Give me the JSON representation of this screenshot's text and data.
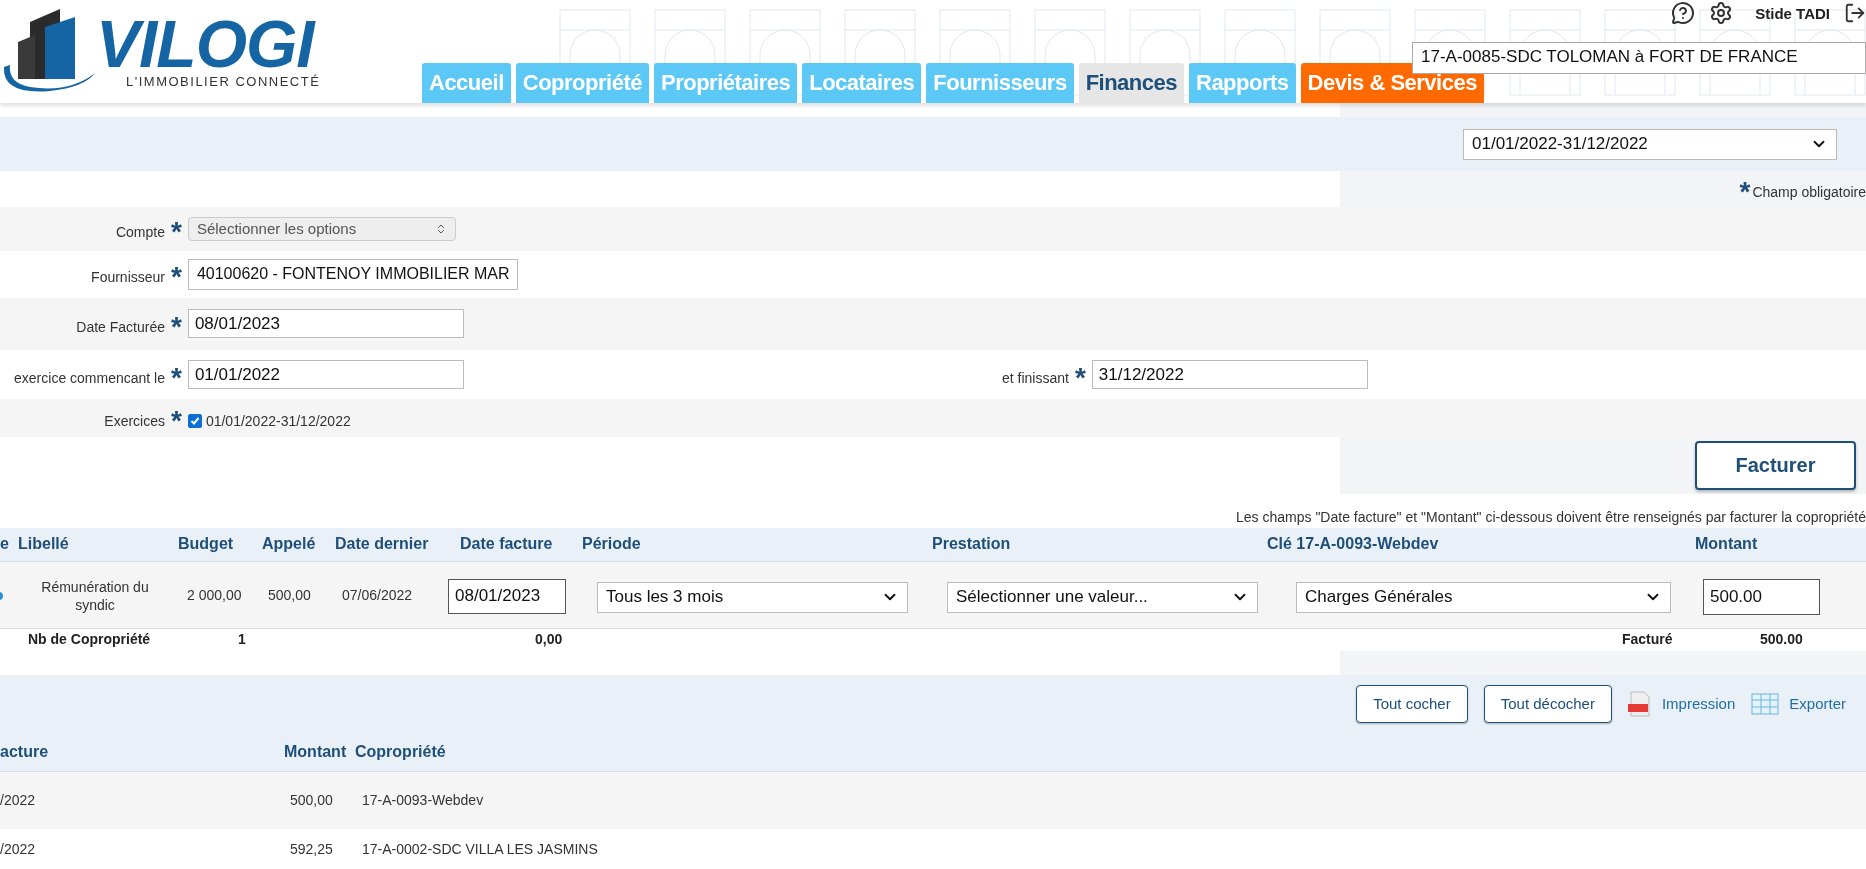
{
  "header": {
    "logo": {
      "name": "VILOGI",
      "tagline": "L'IMMOBILIER CONNECTÉ"
    },
    "tabs": [
      {
        "label": "Accueil",
        "selected": false,
        "kind": "normal"
      },
      {
        "label": "Copropriété",
        "selected": false,
        "kind": "normal"
      },
      {
        "label": "Propriétaires",
        "selected": false,
        "kind": "normal"
      },
      {
        "label": "Locataires",
        "selected": false,
        "kind": "normal"
      },
      {
        "label": "Fournisseurs",
        "selected": false,
        "kind": "normal"
      },
      {
        "label": "Finances",
        "selected": true,
        "kind": "normal"
      },
      {
        "label": "Rapports",
        "selected": false,
        "kind": "normal"
      },
      {
        "label": "Devis & Services",
        "selected": false,
        "kind": "highlight"
      }
    ],
    "user": "Stide TADI",
    "copropriete": "17-A-0085-SDC TOLOMAN à FORT DE FRANCE"
  },
  "period_select": "01/01/2022-31/12/2022",
  "required_note": {
    "mark": "*",
    "label": "Champ obligatoire"
  },
  "form": [
    {
      "kind": "multiselect",
      "label": "Compte",
      "mark": "*",
      "placeholder": "Sélectionner les options"
    },
    {
      "kind": "select",
      "label": "Fournisseur",
      "mark": "*",
      "value": "40100620 - FONTENOY IMMOBILIER MAR"
    },
    {
      "kind": "input",
      "label": "Date Facturée",
      "mark": "*",
      "value": "08/01/2023"
    },
    {
      "kind": "input",
      "label": "exercice commencant le",
      "mark": "*",
      "value": "01/01/2022",
      "second": {
        "label": "et finissant",
        "mark": "*",
        "value": "31/12/2022"
      }
    },
    {
      "kind": "checkbox",
      "label": "Exercices",
      "mark": "*",
      "checked": true,
      "value": "01/01/2022-31/12/2022"
    }
  ],
  "facturer_button": "Facturer",
  "note": "Les champs \"Date facture\" et \"Montant\" ci-dessous doivent être renseignés par facturer la copropriété",
  "table": {
    "columns": [
      "e",
      "Libellé",
      "Budget",
      "Appelé",
      "Date dernier",
      "Date facture",
      "Période",
      "Prestation",
      "Clé 17-A-0093-Webdev",
      "Montant"
    ],
    "rows": [
      {
        "libelle": "Rémunération du syndic",
        "budget": "2 000,00",
        "appele": "500,00",
        "date_dernier": "07/06/2022",
        "date_facture": "08/01/2023",
        "periode": "Tous les 3 mois",
        "prestation": "Sélectionner une valeur...",
        "cle": "Charges Générales",
        "montant": "500.00"
      }
    ],
    "footer": {
      "label": "Nb de Copropriété",
      "count": "1",
      "total": "0,00",
      "factured_label": "Facturé",
      "factured_total": "500.00"
    }
  },
  "actions": {
    "buttons": [
      "Tout cocher",
      "Tout décocher"
    ],
    "links": [
      {
        "kind": "pdf",
        "label": "Impression"
      },
      {
        "kind": "sheet",
        "label": "Exporter"
      }
    ]
  },
  "list": {
    "columns": [
      "acture",
      "Montant",
      "Copropriété"
    ],
    "rows": [
      {
        "date": "/2022",
        "montant": "500,00",
        "copropriete": "17-A-0093-Webdev"
      },
      {
        "date": "/2022",
        "montant": "592,25",
        "copropriete": "17-A-0002-SDC VILLA LES JASMINS"
      }
    ]
  }
}
